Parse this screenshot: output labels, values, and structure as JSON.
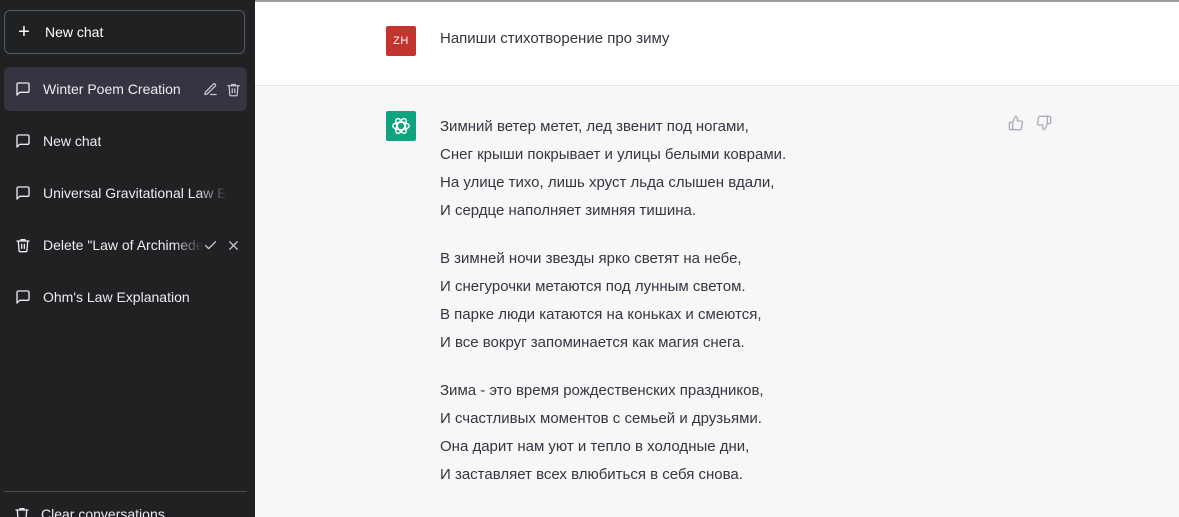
{
  "sidebar": {
    "new_chat_label": "New chat",
    "items": [
      {
        "label": "Winter Poem Creation",
        "icon": "chat-bubble-icon",
        "active": true
      },
      {
        "label": "New chat",
        "icon": "chat-bubble-icon"
      },
      {
        "label": "Universal Gravitational Law E",
        "icon": "chat-bubble-icon"
      },
      {
        "label": "Delete \"Law of Archimedes\" E",
        "icon": "trash-icon"
      },
      {
        "label": "Ohm's Law Explanation",
        "icon": "chat-bubble-icon"
      }
    ],
    "clear_label": "Clear conversations"
  },
  "conversation": {
    "user": {
      "initials": "ZH",
      "avatar_color": "#c4342e",
      "message": "Напиши стихотворение про зиму"
    },
    "assistant": {
      "avatar_color": "#10a37f",
      "stanzas": [
        [
          "Зимний ветер метет, лед звенит под ногами,",
          "Снег крыши покрывает и улицы белыми коврами.",
          "На улице тихо, лишь хруст льда слышен вдали,",
          "И сердце наполняет зимняя тишина."
        ],
        [
          "В зимней ночи звезды ярко светят на небе,",
          "И снегурочки метаются под лунным светом.",
          "В парке люди катаются на коньках и смеются,",
          "И все вокруг запоминается как магия снега."
        ],
        [
          "Зима - это время рождественских праздников,",
          "И счастливых моментов с семьей и друзьями.",
          "Она дарит нам уют и тепло в холодные дни,",
          "И заставляет всех влюбиться в себя снова."
        ]
      ]
    }
  }
}
